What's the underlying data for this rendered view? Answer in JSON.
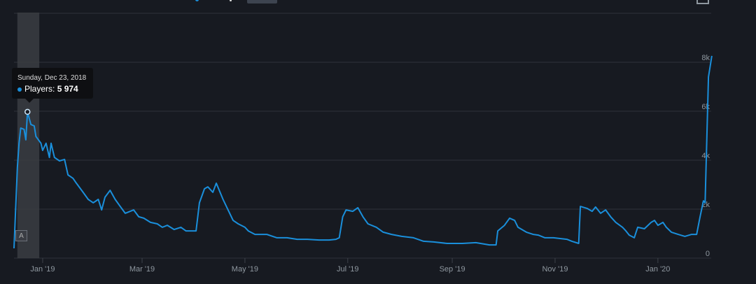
{
  "chart_data": {
    "type": "line",
    "title": "",
    "xlabel": "",
    "ylabel": "",
    "start_date": "2018-12-15",
    "x_unit": "days since start_date",
    "ylim": [
      0,
      10000
    ],
    "y_ticks": [
      0,
      2000,
      4000,
      6000,
      8000
    ],
    "y_tick_labels": [
      "0",
      "2k",
      "4k",
      "6k",
      "8k"
    ],
    "x_ticks": [
      {
        "label": "Jan '19",
        "day": 17
      },
      {
        "label": "Mar '19",
        "day": 76
      },
      {
        "label": "May '19",
        "day": 137
      },
      {
        "label": "Jul '19",
        "day": 198
      },
      {
        "label": "Sep '19",
        "day": 260
      },
      {
        "label": "Nov '19",
        "day": 321
      },
      {
        "label": "Jan '20",
        "day": 382
      }
    ],
    "grid": true,
    "series": [
      {
        "name": "Players",
        "color": "#1a8fdb",
        "x": [
          0,
          2,
          3,
          4,
          6,
          7,
          8,
          10,
          12,
          13,
          16,
          17,
          19,
          21,
          22,
          24,
          27,
          30,
          32,
          35,
          37,
          41,
          44,
          47,
          50,
          52,
          54,
          57,
          60,
          63,
          66,
          71,
          74,
          77,
          81,
          85,
          88,
          91,
          95,
          99,
          102,
          106,
          108,
          110,
          113,
          115,
          118,
          120,
          124,
          127,
          130,
          133,
          137,
          139,
          143,
          150,
          156,
          162,
          168,
          174,
          181,
          187,
          191,
          193,
          195,
          197,
          201,
          204,
          207,
          210,
          215,
          219,
          224,
          230,
          237,
          243,
          249,
          257,
          266,
          274,
          282,
          286,
          287,
          291,
          294,
          297,
          299,
          304,
          308,
          311,
          315,
          320,
          324,
          328,
          331,
          335,
          336,
          340,
          343,
          345,
          348,
          351,
          354,
          357,
          361,
          363,
          365,
          368,
          370,
          374,
          378,
          380,
          382,
          385,
          387,
          390,
          394,
          398,
          402,
          405,
          407,
          409,
          410,
          411,
          412,
          414
        ],
        "values": [
          400,
          3690,
          4690,
          5310,
          5260,
          4830,
          5974,
          5460,
          5400,
          4970,
          4690,
          4400,
          4690,
          4110,
          4690,
          4110,
          3970,
          4030,
          3400,
          3260,
          3060,
          2690,
          2400,
          2260,
          2400,
          1970,
          2490,
          2770,
          2400,
          2110,
          1830,
          1970,
          1690,
          1630,
          1460,
          1400,
          1260,
          1340,
          1170,
          1260,
          1110,
          1110,
          1110,
          2260,
          2830,
          2910,
          2690,
          3060,
          2400,
          1970,
          1540,
          1400,
          1260,
          1110,
          970,
          970,
          830,
          830,
          770,
          770,
          740,
          740,
          770,
          830,
          1690,
          1970,
          1910,
          2060,
          1690,
          1400,
          1260,
          1060,
          970,
          890,
          830,
          690,
          660,
          600,
          600,
          630,
          540,
          540,
          1110,
          1340,
          1630,
          1540,
          1260,
          1060,
          970,
          940,
          830,
          830,
          800,
          770,
          690,
          600,
          2110,
          2030,
          1910,
          2090,
          1830,
          1970,
          1690,
          1460,
          1260,
          1110,
          940,
          830,
          1260,
          1200,
          1460,
          1540,
          1340,
          1460,
          1260,
          1060,
          970,
          890,
          970,
          970,
          1690,
          2340,
          2260,
          4830,
          7400,
          8260
        ]
      }
    ],
    "highlight": {
      "date_label": "Sunday, Dec 23, 2018",
      "series_label": "Players:",
      "value_label": "5 974",
      "day": 8,
      "value": 5974
    },
    "selection_range_days": [
      2,
      15
    ],
    "navigator_label": "A"
  }
}
